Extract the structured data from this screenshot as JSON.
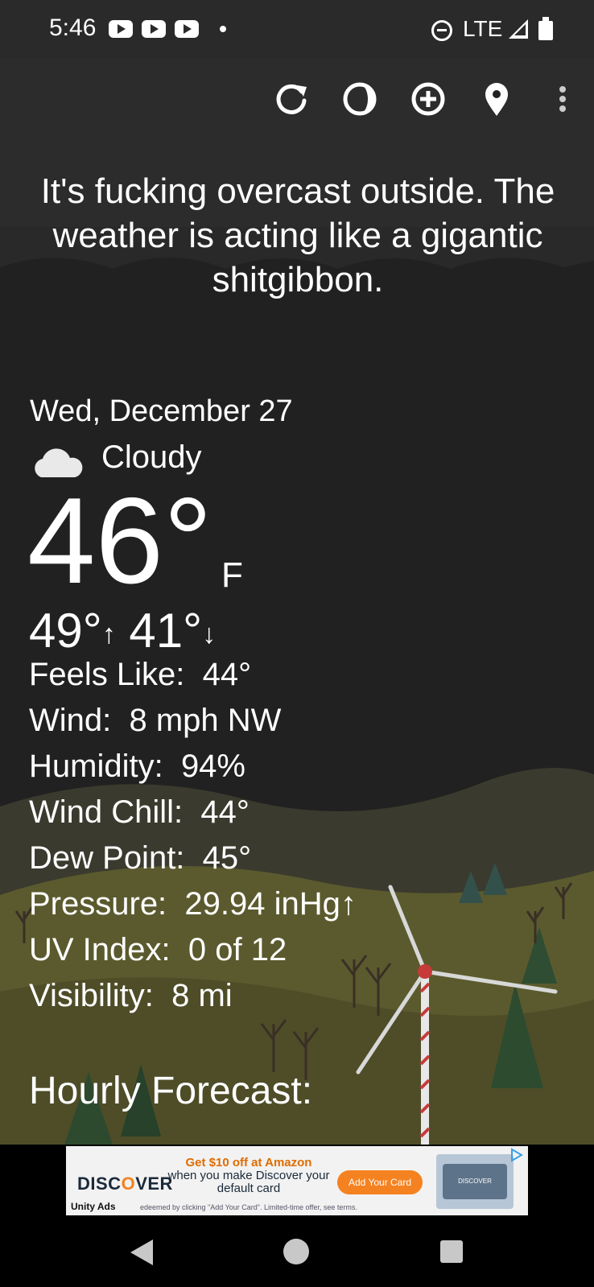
{
  "status_bar": {
    "time": "5:46",
    "network": "LTE",
    "notification_icons": [
      "youtube-icon",
      "youtube-icon",
      "youtube-icon"
    ]
  },
  "toolbar": {
    "icons": [
      "refresh-icon",
      "theme-icon",
      "add-location-icon",
      "location-pin-icon",
      "more-options-icon"
    ]
  },
  "headline": "It's fucking overcast outside. The weather is acting like a gigantic shitgibbon.",
  "current": {
    "date": "Wed, December 27",
    "condition": "Cloudy",
    "condition_icon": "cloud-icon",
    "temperature": "46°",
    "unit": "F",
    "high": "49°",
    "low": "41°"
  },
  "details": [
    {
      "label": "Feels Like:",
      "value": "44°"
    },
    {
      "label": "Wind:",
      "value": "8 mph NW"
    },
    {
      "label": "Humidity:",
      "value": "94%"
    },
    {
      "label": "Wind Chill:",
      "value": "44°"
    },
    {
      "label": "Dew Point:",
      "value": "45°"
    },
    {
      "label": "Pressure:",
      "value": "29.94 inHg↑"
    },
    {
      "label": "UV Index:",
      "value": "0 of 12"
    },
    {
      "label": "Visibility:",
      "value": "8 mi"
    }
  ],
  "hourly_title": "Hourly Forecast:",
  "ad": {
    "brand": "DISC",
    "brand_o": "O",
    "brand_rest": "VER",
    "headline": "Get $10 off at Amazon",
    "sub": "when you make Discover your default card",
    "button": "Add Your Card",
    "card_text": "DISCOVER",
    "unity": "Unity Ads",
    "fine_print": "edeemed by clicking \"Add Your Card\". Limited-time offer, see terms."
  },
  "colors": {
    "background": "#202020",
    "hill": "#5b5a2e",
    "accent": "#f58220"
  }
}
